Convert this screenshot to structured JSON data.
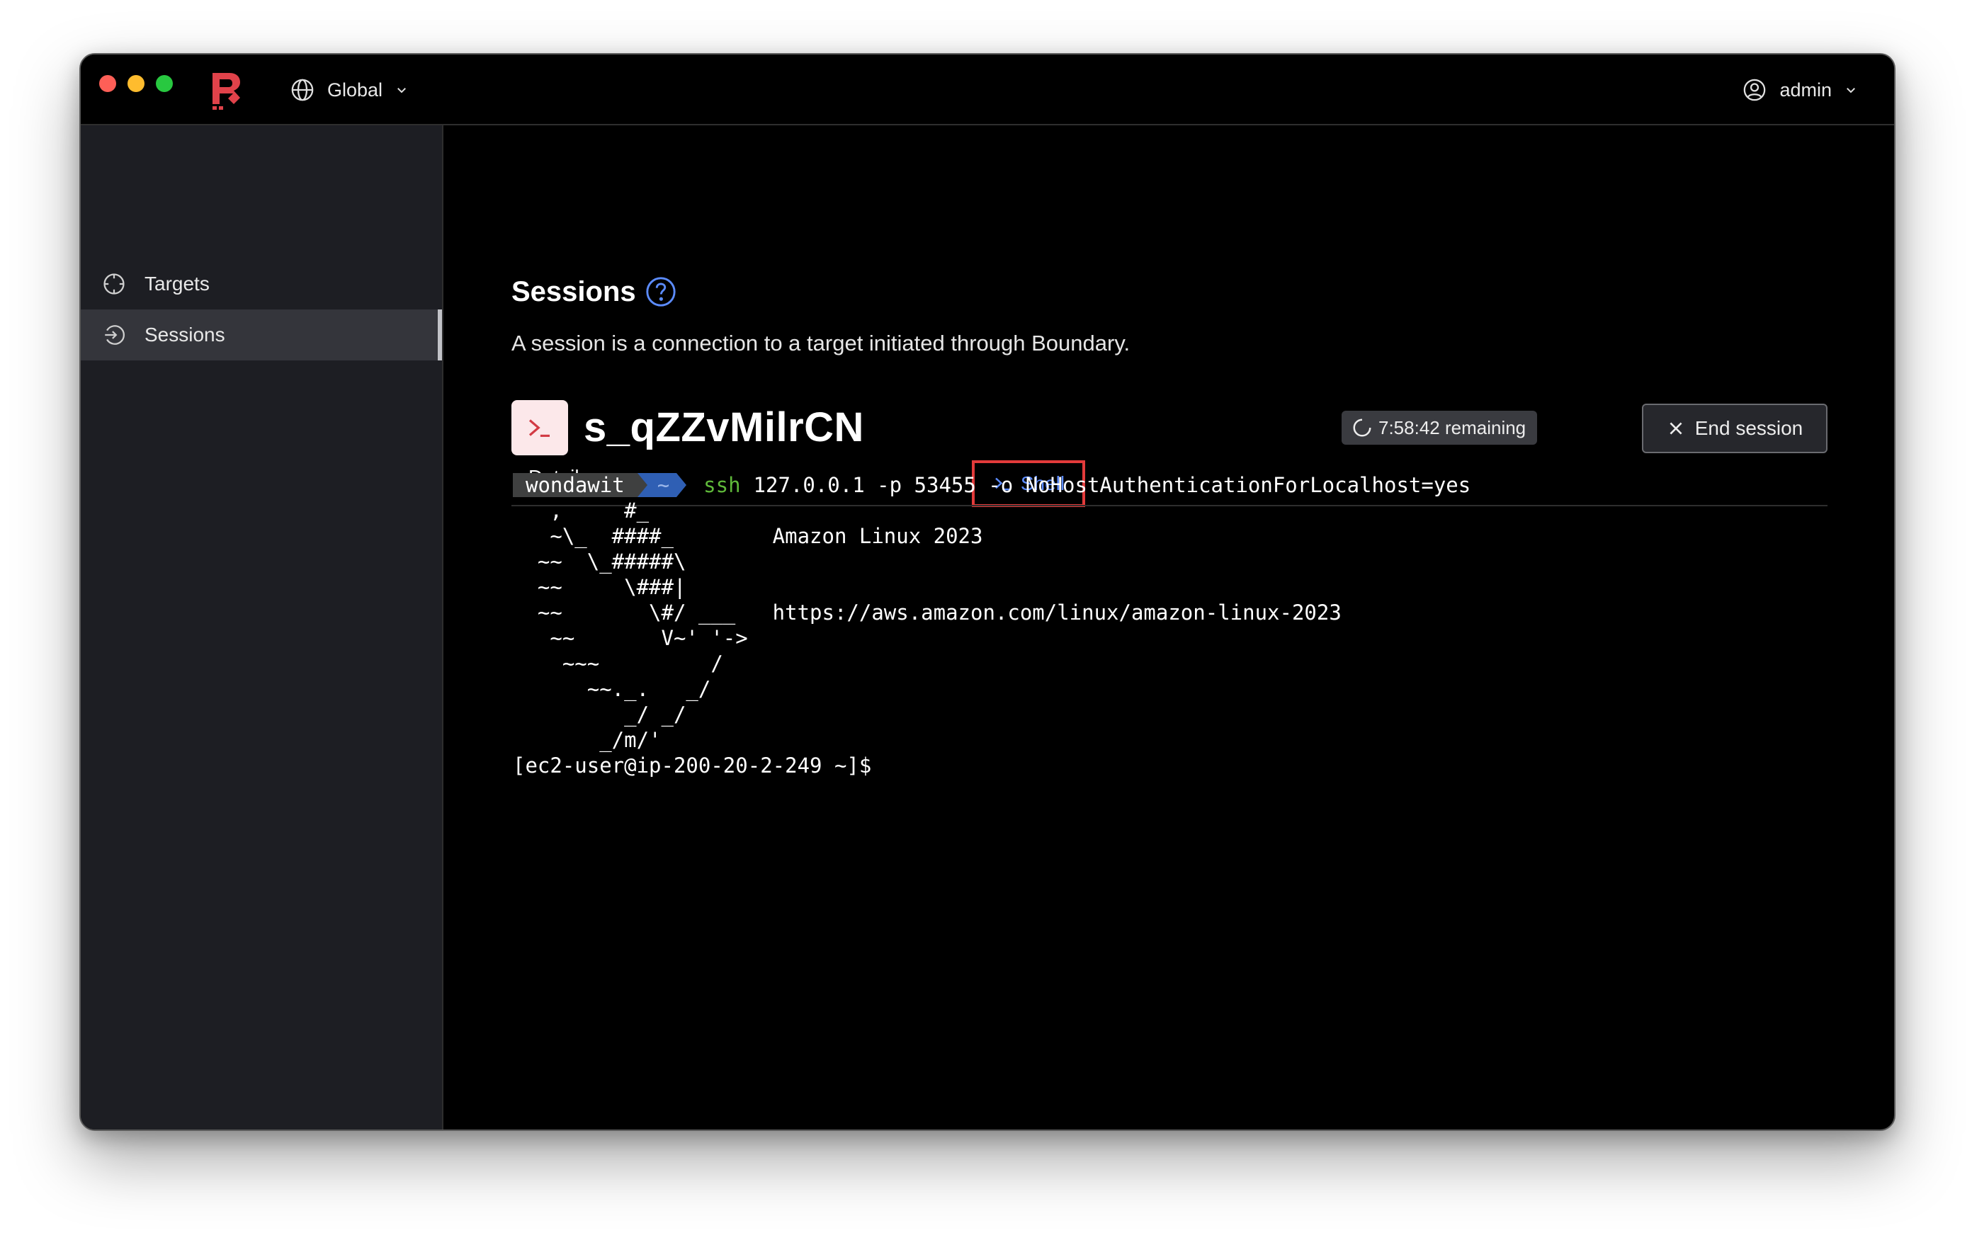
{
  "header": {
    "scope_label": "Global",
    "user_label": "admin"
  },
  "sidebar": {
    "items": [
      {
        "label": "Targets",
        "icon": "crosshair-icon"
      },
      {
        "label": "Sessions",
        "icon": "sign-in-icon",
        "active": true
      }
    ]
  },
  "page": {
    "title": "Sessions",
    "description": "A session is a connection to a target initiated through Boundary."
  },
  "session": {
    "id": "s_qZZvMilrCN",
    "remaining": "7:58:42 remaining",
    "end_label": "End session"
  },
  "tabs": {
    "details": "Details",
    "shell": "Shell"
  },
  "terminal": {
    "prompt_user": "wondawit",
    "prompt_dir": "~",
    "command": "ssh",
    "command_args": "127.0.0.1 -p 53455 -o NoHostAuthenticationForLocalhost=yes",
    "lines": [
      "   ,     #_",
      "   ~\\_  ####_        Amazon Linux 2023",
      "  ~~  \\_#####\\",
      "  ~~     \\###|",
      "  ~~       \\#/ ___   https://aws.amazon.com/linux/amazon-linux-2023",
      "   ~~       V~' '->",
      "    ~~~         /",
      "      ~~._.   _/",
      "         _/ _/",
      "       _/m/'",
      "[ec2-user@ip-200-20-2-249 ~]$"
    ]
  },
  "colors": {
    "accent_blue": "#5c8cff",
    "brand_red": "#e0424a",
    "highlight_box": "#e23a3a"
  }
}
